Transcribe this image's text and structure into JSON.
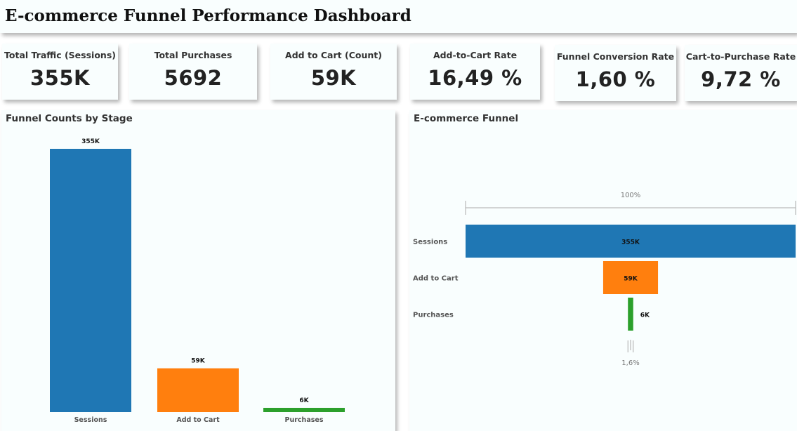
{
  "page_title": "E-commerce Funnel Performance Dashboard",
  "kpis": [
    {
      "label": "Total Traffic (Sessions)",
      "value": "355K"
    },
    {
      "label": "Total Purchases",
      "value": "5692"
    },
    {
      "label": "Add to Cart (Count)",
      "value": "59K"
    },
    {
      "label": "Add-to-Cart Rate",
      "value": "16,49 %"
    },
    {
      "label": "Funnel Conversion Rate",
      "value": "1,60 %"
    },
    {
      "label": "Cart-to-Purchase Rate",
      "value": "9,72 %"
    }
  ],
  "chart_data": [
    {
      "type": "bar",
      "title": "Funnel Counts by Stage",
      "categories": [
        "Sessions",
        "Add to Cart",
        "Purchases"
      ],
      "values": [
        355000,
        59000,
        5692
      ],
      "data_labels": [
        "355K",
        "59K",
        "6K"
      ],
      "colors": [
        "#1f77b4",
        "#ff7f0e",
        "#2ca02c"
      ],
      "ylim": [
        0,
        355000
      ],
      "xlabel": "",
      "ylabel": "",
      "grid": false
    },
    {
      "type": "funnel",
      "title": "E-commerce Funnel",
      "categories": [
        "Sessions",
        "Add to Cart",
        "Purchases"
      ],
      "values": [
        355000,
        59000,
        5692
      ],
      "data_labels": [
        "355K",
        "59K",
        "6K"
      ],
      "colors": [
        "#1f77b4",
        "#ff7f0e",
        "#2ca02c"
      ],
      "top_percent_label": "100%",
      "bottom_percent_label": "1,6%"
    }
  ]
}
